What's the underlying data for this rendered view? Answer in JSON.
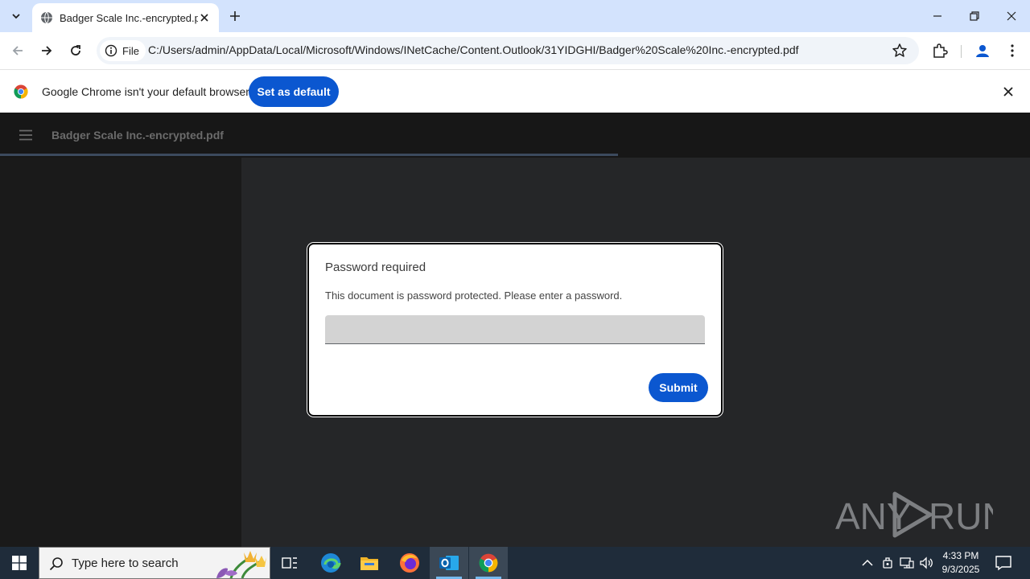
{
  "browser": {
    "tab_title": "Badger Scale Inc.-encrypted.pdf",
    "url_chip": "File",
    "url": "C:/Users/admin/AppData/Local/Microsoft/Windows/INetCache/Content.Outlook/31YIDGHI/Badger%20Scale%20Inc.-encrypted.pdf"
  },
  "infobar": {
    "message": "Google Chrome isn't your default browser",
    "set_default_label": "Set as default"
  },
  "pdf_viewer": {
    "file_title": "Badger Scale Inc.-encrypted.pdf",
    "loading_progress": 0.6
  },
  "dialog": {
    "title": "Password required",
    "message": "This document is password protected. Please enter a password.",
    "password_value": "",
    "submit_label": "Submit"
  },
  "watermark": {
    "text_left": "ANY",
    "text_right": "RUN"
  },
  "taskbar": {
    "search_placeholder": "Type here to search",
    "time": "4:33 PM",
    "date": "9/3/2025"
  },
  "colors": {
    "accent": "#0b57d0",
    "tabstrip": "#d3e3fd",
    "taskbar": "#1f2c3a"
  }
}
